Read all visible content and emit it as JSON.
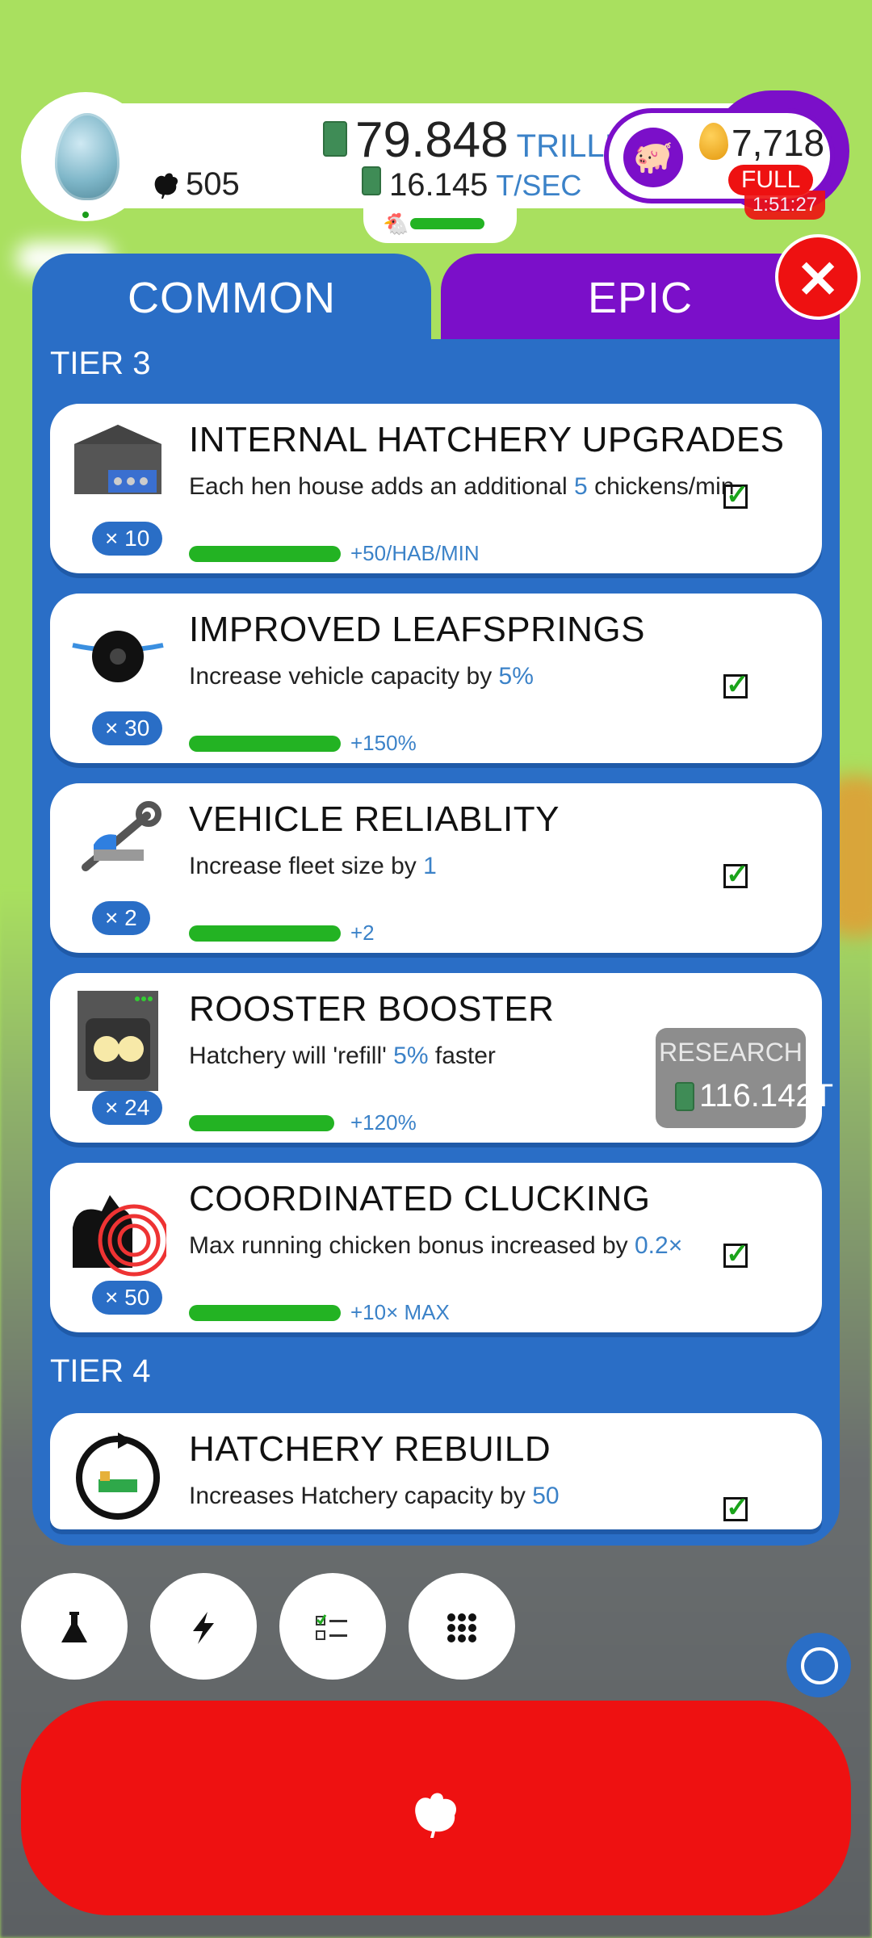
{
  "header": {
    "chicken_count": "505",
    "money_value": "79.848",
    "money_unit": "TRILLION",
    "rate_value": "16.145",
    "rate_unit": "T/SEC",
    "golden_eggs": "7,718",
    "full_badge": "FULL",
    "timer": "1:51:27"
  },
  "tabs": [
    {
      "label": "COMMON"
    },
    {
      "label": "EPIC"
    }
  ],
  "tiers": {
    "tier3": "TIER 3",
    "tier4": "TIER 4"
  },
  "research_items": [
    {
      "title": "INTERNAL HATCHERY UPGRADES",
      "desc_pre": "Each hen house adds an additional ",
      "desc_hl": "5",
      "desc_post": " chickens/min",
      "multiplier": "× 10",
      "gain": "+50/HAB/MIN",
      "progress": 1.0,
      "icon": "hen-house-icon",
      "completed": true
    },
    {
      "title": "IMPROVED LEAFSPRINGS",
      "desc_pre": "Increase vehicle capacity by ",
      "desc_hl": "5%",
      "desc_post": "",
      "multiplier": "× 30",
      "gain": "+150%",
      "progress": 1.0,
      "icon": "leafspring-wheel-icon",
      "completed": true
    },
    {
      "title": "VEHICLE RELIABLITY",
      "desc_pre": "Increase fleet size by ",
      "desc_hl": "1",
      "desc_post": "",
      "multiplier": "× 2",
      "gain": "+2",
      "progress": 1.0,
      "icon": "wrench-truck-icon",
      "completed": true
    },
    {
      "title": "ROOSTER BOOSTER",
      "desc_pre": "Hatchery will 'refill' ",
      "desc_hl": "5%",
      "desc_post": " faster",
      "multiplier": "× 24",
      "gain": "+120%",
      "progress": 0.96,
      "icon": "incubator-icon",
      "completed": false,
      "research_label": "RESEARCH",
      "research_price": "116.142T"
    },
    {
      "title": "COORDINATED CLUCKING",
      "desc_pre": "Max running chicken bonus increased by ",
      "desc_hl": "0.2×",
      "desc_post": "",
      "multiplier": "× 50",
      "gain": "+10× MAX",
      "progress": 1.0,
      "icon": "clucking-chicken-icon",
      "completed": true
    },
    {
      "title": "HATCHERY REBUILD",
      "desc_pre": "Increases Hatchery capacity by ",
      "desc_hl": "50",
      "desc_post": "",
      "icon": "hatchery-rebuild-icon",
      "completed": true
    }
  ],
  "bottom_buttons": [
    {
      "icon": "flask-icon"
    },
    {
      "icon": "lightning-icon"
    },
    {
      "icon": "checklist-icon"
    },
    {
      "icon": "grid-icon"
    }
  ],
  "colors": {
    "background": "#a9e05f",
    "panel_blue": "#2a6ec6",
    "epic_purple": "#7b0fc9",
    "accent_red": "#ee1111",
    "progress_green": "#23b323",
    "highlight_blue": "#3b82c8"
  }
}
